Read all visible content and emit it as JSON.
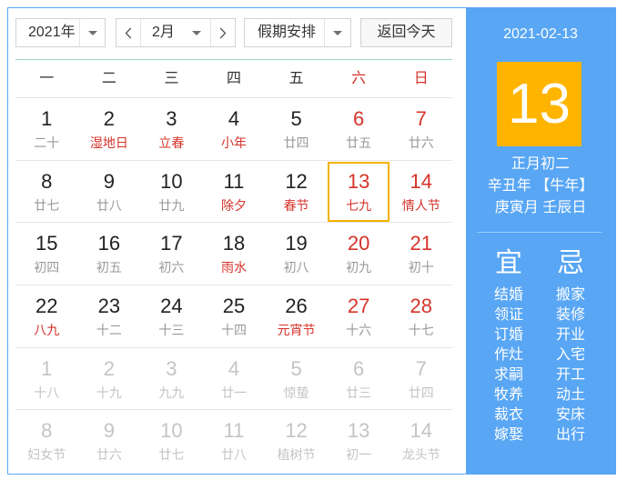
{
  "colors": {
    "accent": "#58a6f4",
    "today": "#ffb400",
    "selected_border": "#f5b300",
    "holiday_red": "#d6332b",
    "lunar_gray": "#999999",
    "other_month": "#c4c4c4"
  },
  "icons": {
    "dropdown": "caret-down-icon",
    "prev": "chevron-left-icon",
    "next": "chevron-right-icon"
  },
  "toolbar": {
    "year": "2021年",
    "month": "2月",
    "holiday": "假期安排",
    "today_button": "返回今天"
  },
  "weekdays": [
    {
      "label": "一",
      "weekend": false
    },
    {
      "label": "二",
      "weekend": false
    },
    {
      "label": "三",
      "weekend": false
    },
    {
      "label": "四",
      "weekend": false
    },
    {
      "label": "五",
      "weekend": false
    },
    {
      "label": "六",
      "weekend": true
    },
    {
      "label": "日",
      "weekend": true
    }
  ],
  "weeks": [
    [
      {
        "day": "1",
        "lunar": "二十"
      },
      {
        "day": "2",
        "lunar": "湿地日",
        "festival": true
      },
      {
        "day": "3",
        "lunar": "立春",
        "festival": true
      },
      {
        "day": "4",
        "lunar": "小年",
        "festival": true
      },
      {
        "day": "5",
        "lunar": "廿四"
      },
      {
        "day": "6",
        "lunar": "廿五",
        "weekend": true
      },
      {
        "day": "7",
        "lunar": "廿六",
        "weekend": true
      }
    ],
    [
      {
        "day": "8",
        "lunar": "廿七"
      },
      {
        "day": "9",
        "lunar": "廿八"
      },
      {
        "day": "10",
        "lunar": "廿九"
      },
      {
        "day": "11",
        "lunar": "除夕",
        "festival": true
      },
      {
        "day": "12",
        "lunar": "春节",
        "festival": true
      },
      {
        "day": "13",
        "lunar": "七九",
        "weekend": true,
        "festival": true,
        "selected": true
      },
      {
        "day": "14",
        "lunar": "情人节",
        "weekend": true,
        "festival": true
      }
    ],
    [
      {
        "day": "15",
        "lunar": "初四"
      },
      {
        "day": "16",
        "lunar": "初五"
      },
      {
        "day": "17",
        "lunar": "初六"
      },
      {
        "day": "18",
        "lunar": "雨水",
        "festival": true
      },
      {
        "day": "19",
        "lunar": "初八"
      },
      {
        "day": "20",
        "lunar": "初九",
        "weekend": true
      },
      {
        "day": "21",
        "lunar": "初十",
        "weekend": true
      }
    ],
    [
      {
        "day": "22",
        "lunar": "八九",
        "festival": true
      },
      {
        "day": "23",
        "lunar": "十二"
      },
      {
        "day": "24",
        "lunar": "十三"
      },
      {
        "day": "25",
        "lunar": "十四"
      },
      {
        "day": "26",
        "lunar": "元宵节",
        "festival": true
      },
      {
        "day": "27",
        "lunar": "十六",
        "weekend": true
      },
      {
        "day": "28",
        "lunar": "十七",
        "weekend": true
      }
    ],
    [
      {
        "day": "1",
        "lunar": "十八",
        "other_month": true
      },
      {
        "day": "2",
        "lunar": "十九",
        "other_month": true
      },
      {
        "day": "3",
        "lunar": "九九",
        "other_month": true
      },
      {
        "day": "4",
        "lunar": "廿一",
        "other_month": true
      },
      {
        "day": "5",
        "lunar": "惊蛰",
        "other_month": true
      },
      {
        "day": "6",
        "lunar": "廿三",
        "other_month": true
      },
      {
        "day": "7",
        "lunar": "廿四",
        "other_month": true
      }
    ],
    [
      {
        "day": "8",
        "lunar": "妇女节",
        "other_month": true
      },
      {
        "day": "9",
        "lunar": "廿六",
        "other_month": true
      },
      {
        "day": "10",
        "lunar": "廿七",
        "other_month": true
      },
      {
        "day": "11",
        "lunar": "廿八",
        "other_month": true
      },
      {
        "day": "12",
        "lunar": "植树节",
        "other_month": true
      },
      {
        "day": "13",
        "lunar": "初一",
        "other_month": true
      },
      {
        "day": "14",
        "lunar": "龙头节",
        "other_month": true
      }
    ]
  ],
  "side": {
    "date": "2021-02-13",
    "day": "13",
    "lunar_date": "正月初二",
    "year_line": "辛丑年 【牛年】",
    "month_day_line": "庚寅月 壬辰日",
    "yi": {
      "title": "宜",
      "items": [
        "结婚",
        "领证",
        "订婚",
        "作灶",
        "求嗣",
        "牧养",
        "裁衣",
        "嫁娶"
      ]
    },
    "ji": {
      "title": "忌",
      "items": [
        "搬家",
        "装修",
        "开业",
        "入宅",
        "开工",
        "动土",
        "安床",
        "出行"
      ]
    }
  }
}
